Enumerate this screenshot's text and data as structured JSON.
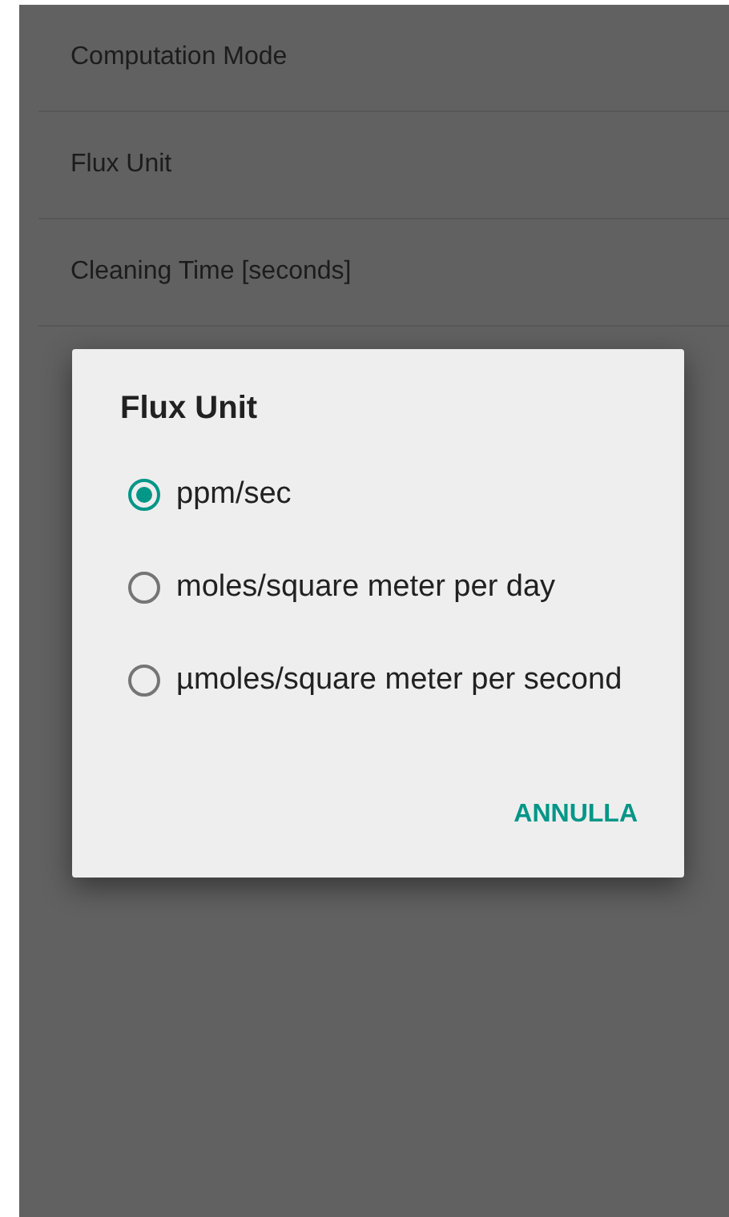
{
  "settings": [
    {
      "label": "Computation Mode"
    },
    {
      "label": "Flux Unit"
    },
    {
      "label": "Cleaning Time [seconds]"
    }
  ],
  "dialog": {
    "title": "Flux Unit",
    "options": [
      {
        "label": "ppm/sec",
        "selected": true
      },
      {
        "label": "moles/square meter per day",
        "selected": false
      },
      {
        "label": "µmoles/square meter per second",
        "selected": false
      }
    ],
    "buttons": [
      "ANNULLA"
    ]
  }
}
